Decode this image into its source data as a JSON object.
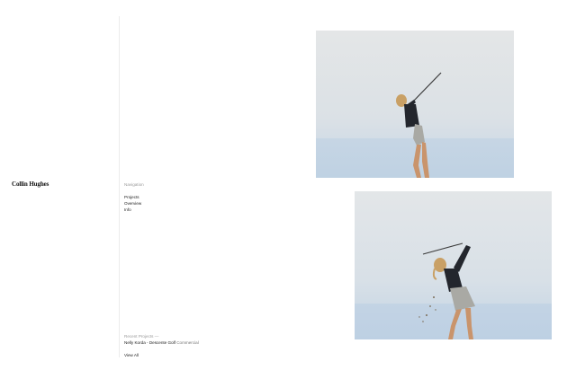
{
  "brand": {
    "name": "Collin Hughes"
  },
  "navigation": {
    "heading": "Navigation",
    "items": [
      {
        "label": "Projects"
      },
      {
        "label": "Overview"
      },
      {
        "label": "Info"
      }
    ]
  },
  "recent_projects": {
    "heading": "Recent Projects —",
    "item": {
      "title": "Nelly Korda - Descente Golf",
      "category": "Commercial"
    },
    "view_all_label": "View All"
  },
  "gallery": {
    "photos": [
      {
        "subject": "golfer-follow-through-photo"
      },
      {
        "subject": "golfer-swing-divot-photo"
      }
    ]
  },
  "colors": {
    "sky_top": "#e3e6e8",
    "sky_bottom": "#cdd9e4",
    "haze": "#b7cbe0",
    "top": "#23262d",
    "skirt": "#a9a9a4",
    "skin": "#c9946c",
    "hair": "#c9a065"
  }
}
